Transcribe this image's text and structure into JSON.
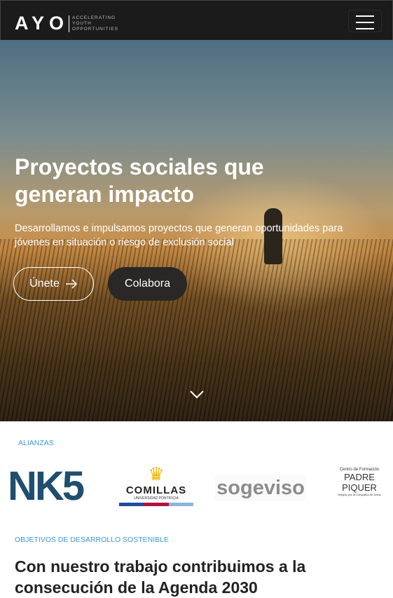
{
  "nav": {
    "logo_main": "AYO",
    "logo_sub": [
      "ACCELERATING",
      "YOUTH",
      "OPPORTUNITIES"
    ],
    "menu_icon": "hamburger-icon"
  },
  "hero": {
    "title": "Proyectos sociales que generan impacto",
    "lead": "Desarrollamos e impulsamos proyectos que generan oportunidades para jóvenes en situación o riesgo de exclusión social",
    "join_label": "Únete",
    "collaborate_label": "Colabora"
  },
  "alliances": {
    "label": "ALIANZAS",
    "logos": {
      "nk5": "NK5",
      "comillas": "COMILLAS",
      "comillas_sub": "UNIVERSIDAD PONTIFICIA",
      "sogeviso": "sogeviso",
      "piquer_top": "Centro de Formación",
      "piquer": "PADRE PIQUER",
      "piquer_sub": "Dirigido por la Compañía de Jesús"
    }
  },
  "ods": {
    "label": "OBJETIVOS DE DESARROLLO SOSTENIBLE",
    "title": "Con nuestro trabajo contribuimos a la consecución de la Agenda 2030"
  }
}
